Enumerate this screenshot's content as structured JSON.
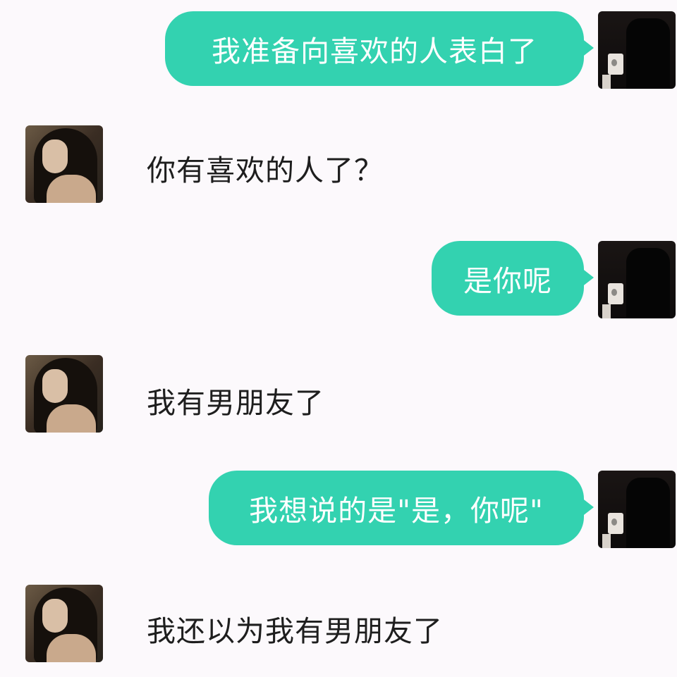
{
  "messages": [
    {
      "side": "sent",
      "text": "我准备向喜欢的人表白了"
    },
    {
      "side": "received",
      "text": "你有喜欢的人了？"
    },
    {
      "side": "sent",
      "text": "是你呢"
    },
    {
      "side": "received",
      "text": "我有男朋友了"
    },
    {
      "side": "sent",
      "text": "我想说的是\"是，你呢\""
    },
    {
      "side": "received",
      "text": "我还以为我有男朋友了"
    }
  ],
  "colors": {
    "sent_bubble": "#33d2b0",
    "sent_text": "#ffffff",
    "received_text": "#1e1e1e",
    "background": "#fcf9fc"
  },
  "icons": {
    "sender_avatar": "avatar-photo-man-dark",
    "receiver_avatar": "avatar-photo-woman"
  }
}
